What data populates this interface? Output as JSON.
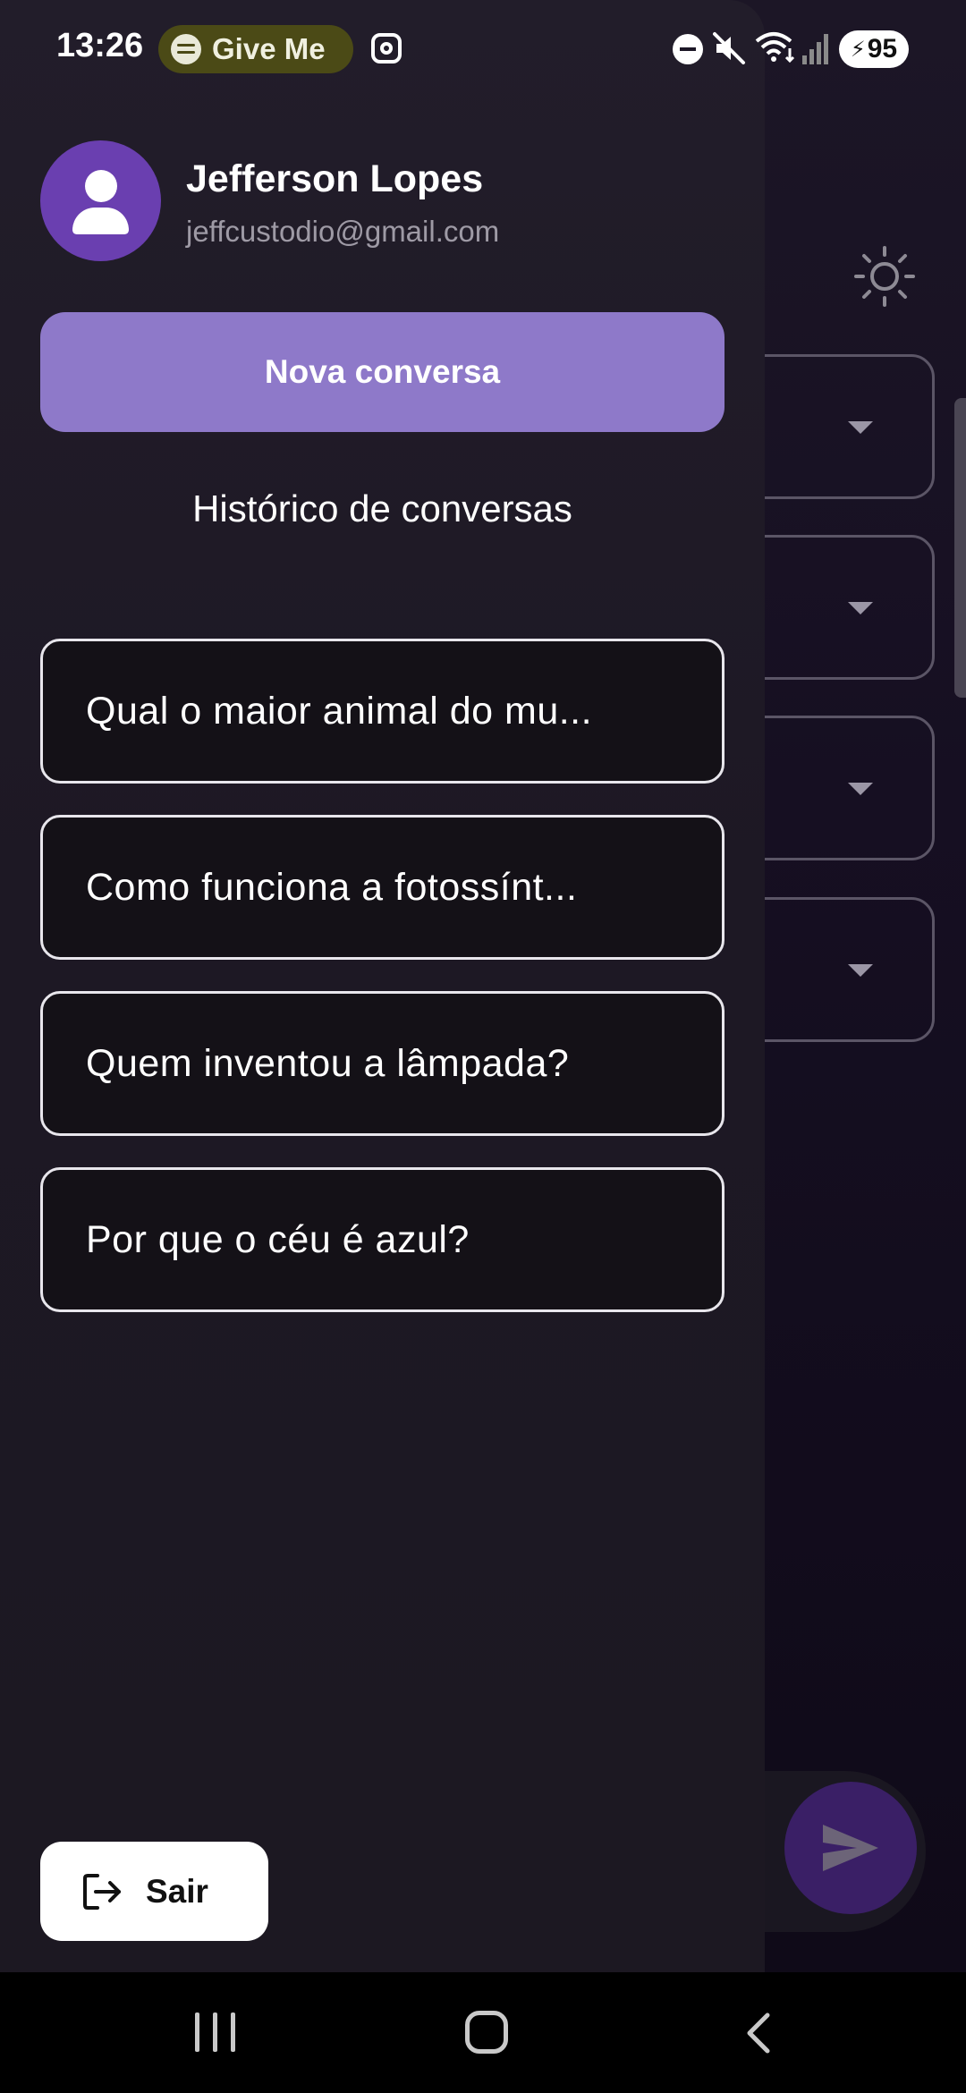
{
  "status_bar": {
    "time": "13:26",
    "media_text": "Give Me",
    "battery": "95"
  },
  "drawer": {
    "user": {
      "name": "Jefferson Lopes",
      "email": "jeffcustodio@gmail.com"
    },
    "new_chat_label": "Nova conversa",
    "history_title": "Histórico de conversas",
    "history": [
      "Qual o maior animal do mu...",
      "Como funciona a fotossínt...",
      "Quem inventou a lâmpada?",
      "Por que o céu é azul?"
    ],
    "logout_label": "Sair"
  },
  "colors": {
    "accent": "#8e79c9",
    "avatar": "#6a3fb0",
    "drawer_bg": "#1d1824"
  }
}
